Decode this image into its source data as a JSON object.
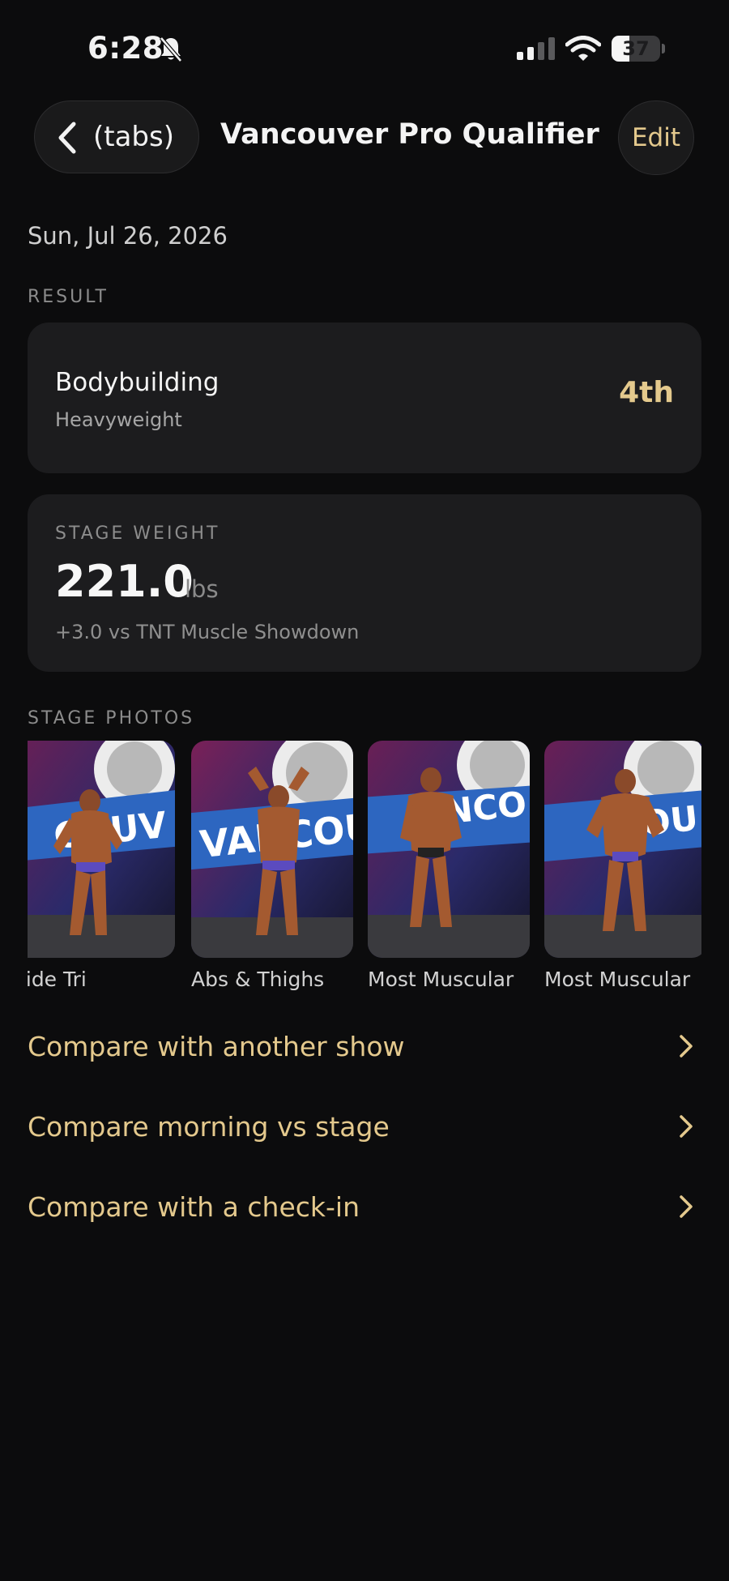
{
  "status_bar": {
    "time": "6:28",
    "battery": "37",
    "battery_level": 0.37,
    "icons": [
      "bell-slash-icon",
      "cellular-signal-icon",
      "wifi-icon",
      "battery-icon"
    ]
  },
  "nav": {
    "back_label": "(tabs)",
    "title": "Vancouver Pro Qualifier",
    "edit_label": "Edit"
  },
  "date": "Sun, Jul 26, 2026",
  "result": {
    "section_label": "RESULT",
    "division": "Bodybuilding",
    "class": "Heavyweight",
    "placing": "4th"
  },
  "stage_weight": {
    "label": "STAGE WEIGHT",
    "value": "221.0",
    "unit": "lbs",
    "comparison": "+3.0 vs TNT Muscle Showdown"
  },
  "stage_photos": {
    "section_label": "STAGE PHOTOS",
    "items": [
      {
        "caption": "Side Tri"
      },
      {
        "caption": "Abs & Thighs"
      },
      {
        "caption": "Most Muscular"
      },
      {
        "caption": "Most Muscular"
      }
    ]
  },
  "actions": [
    {
      "label": "Compare with another show"
    },
    {
      "label": "Compare morning vs stage"
    },
    {
      "label": "Compare with a check-in"
    }
  ],
  "colors": {
    "background": "#0c0c0d",
    "card": "#1c1c1e",
    "accent": "#e4c98d"
  }
}
